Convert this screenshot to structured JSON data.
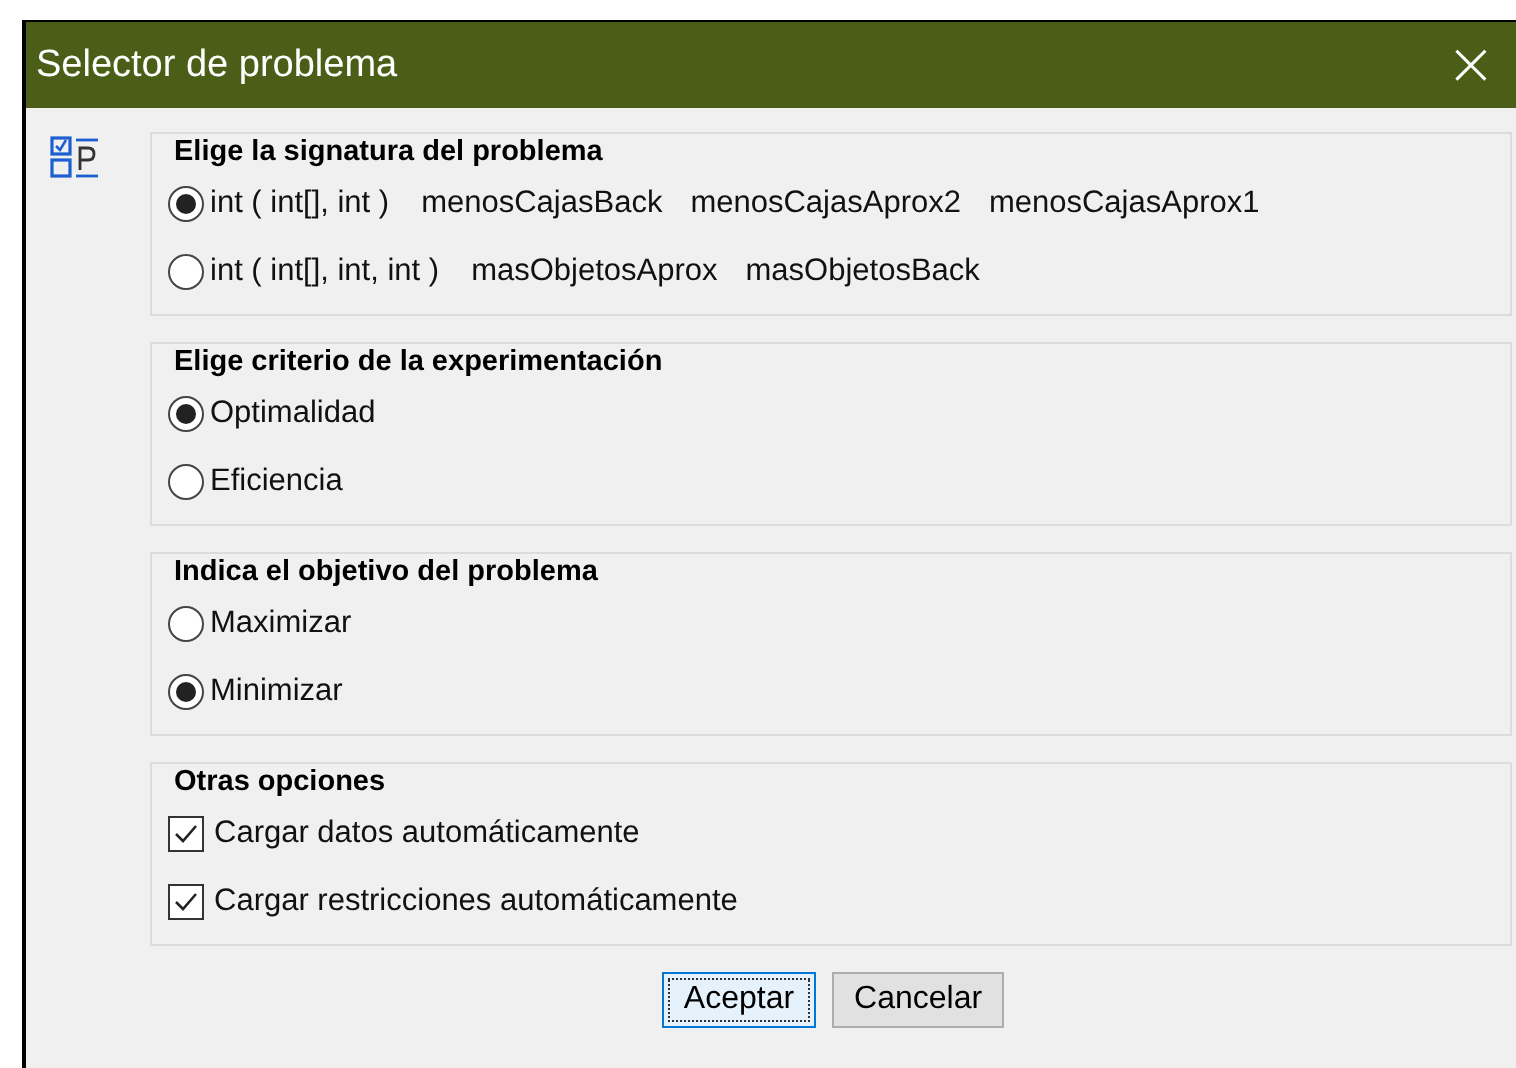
{
  "window": {
    "title": "Selector de problema",
    "close": "×"
  },
  "sections": [
    {
      "title": "Elige la signatura del problema",
      "kind": "radio",
      "options": [
        {
          "label": "int ( int[], int )",
          "selected": true,
          "methods": [
            "menosCajasBack",
            "menosCajasAprox2",
            "menosCajasAprox1"
          ]
        },
        {
          "label": "int ( int[], int, int )",
          "selected": false,
          "methods": [
            "masObjetosAprox",
            "masObjetosBack"
          ]
        }
      ]
    },
    {
      "title": "Elige criterio de la experimentación",
      "kind": "radio",
      "options": [
        {
          "label": "Optimalidad",
          "selected": true
        },
        {
          "label": "Eficiencia",
          "selected": false
        }
      ]
    },
    {
      "title": "Indica el objetivo del problema",
      "kind": "radio",
      "options": [
        {
          "label": "Maximizar",
          "selected": false
        },
        {
          "label": "Minimizar",
          "selected": true
        }
      ]
    },
    {
      "title": "Otras opciones",
      "kind": "check",
      "options": [
        {
          "label": "Cargar datos automáticamente",
          "checked": true
        },
        {
          "label": "Cargar restricciones automáticamente",
          "checked": true
        }
      ]
    }
  ],
  "buttons": [
    {
      "label": "Aceptar",
      "default": true
    },
    {
      "label": "Cancelar",
      "default": false
    }
  ]
}
